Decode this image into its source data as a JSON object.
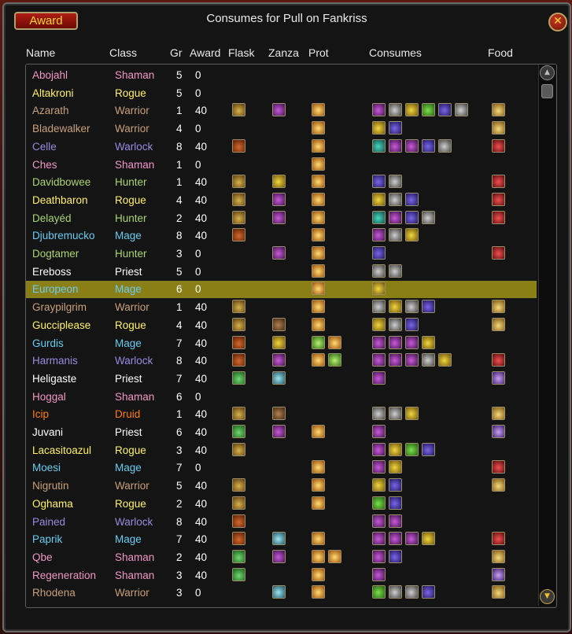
{
  "window": {
    "title": "Consumes for Pull on Fankriss",
    "award_button": "Award",
    "close_glyph": "✕"
  },
  "colors": {
    "Shaman": "#f097c6",
    "Rogue": "#fff26a",
    "Warrior": "#c8a07a",
    "Warlock": "#9a8ae0",
    "Hunter": "#abd473",
    "Mage": "#69ccf0",
    "Priest": "#ffffff",
    "Druid": "#ff7d0a"
  },
  "columns": {
    "name": "Name",
    "class": "Class",
    "gr": "Gr",
    "award": "Award",
    "flask": "Flask",
    "zanza": "Zanza",
    "prot": "Prot",
    "consumes": "Consumes",
    "food": "Food"
  },
  "rows": [
    {
      "name": "Abojahl",
      "class": "Shaman",
      "gr": "5",
      "award": "0",
      "flask": [],
      "zanza": [],
      "prot": [],
      "consumes": [],
      "food": []
    },
    {
      "name": "Altakroni",
      "class": "Rogue",
      "gr": "5",
      "award": "0",
      "flask": [],
      "zanza": [],
      "prot": [],
      "consumes": [],
      "food": []
    },
    {
      "name": "Azarath",
      "class": "Warrior",
      "gr": "1",
      "award": "40",
      "flask": [
        "flask"
      ],
      "zanza": [
        "purple"
      ],
      "prot": [
        "prot"
      ],
      "consumes": [
        "purple",
        "gray",
        "yellow",
        "green",
        "blue",
        "gray"
      ],
      "food": [
        "food"
      ]
    },
    {
      "name": "Bladewalker",
      "class": "Warrior",
      "gr": "4",
      "award": "0",
      "flask": [],
      "zanza": [],
      "prot": [
        "prot"
      ],
      "consumes": [
        "yellow",
        "blue"
      ],
      "food": [
        "food"
      ]
    },
    {
      "name": "Celle",
      "class": "Warlock",
      "gr": "8",
      "award": "40",
      "flask": [
        "flask-red"
      ],
      "zanza": [],
      "prot": [
        "prot"
      ],
      "consumes": [
        "teal",
        "purple",
        "purple",
        "blue",
        "gray"
      ],
      "food": [
        "food-red"
      ]
    },
    {
      "name": "Ches",
      "class": "Shaman",
      "gr": "1",
      "award": "0",
      "flask": [],
      "zanza": [],
      "prot": [
        "prot"
      ],
      "consumes": [],
      "food": []
    },
    {
      "name": "Davidbowee",
      "class": "Hunter",
      "gr": "1",
      "award": "40",
      "flask": [
        "flask"
      ],
      "zanza": [
        "yellow"
      ],
      "prot": [
        "prot"
      ],
      "consumes": [
        "blue",
        "gray"
      ],
      "food": [
        "food-red"
      ]
    },
    {
      "name": "Deathbaron",
      "class": "Rogue",
      "gr": "4",
      "award": "40",
      "flask": [
        "flask"
      ],
      "zanza": [
        "purple"
      ],
      "prot": [
        "prot"
      ],
      "consumes": [
        "yellow",
        "gray",
        "blue"
      ],
      "food": [
        "food-red"
      ]
    },
    {
      "name": "Delayéd",
      "class": "Hunter",
      "gr": "2",
      "award": "40",
      "flask": [
        "flask"
      ],
      "zanza": [
        "purple"
      ],
      "prot": [
        "prot"
      ],
      "consumes": [
        "teal",
        "purple",
        "blue",
        "gray"
      ],
      "food": [
        "food-red"
      ]
    },
    {
      "name": "Djubremucko",
      "class": "Mage",
      "gr": "8",
      "award": "40",
      "flask": [
        "flask-red"
      ],
      "zanza": [],
      "prot": [
        "prot"
      ],
      "consumes": [
        "purple",
        "gray",
        "yellow"
      ],
      "food": []
    },
    {
      "name": "Dogtamer",
      "class": "Hunter",
      "gr": "3",
      "award": "0",
      "flask": [],
      "zanza": [
        "purple"
      ],
      "prot": [
        "prot"
      ],
      "consumes": [
        "blue"
      ],
      "food": [
        "food-red"
      ]
    },
    {
      "name": "Ereboss",
      "class": "Priest",
      "gr": "5",
      "award": "0",
      "flask": [],
      "zanza": [],
      "prot": [
        "prot"
      ],
      "consumes": [
        "gray",
        "gray"
      ],
      "food": []
    },
    {
      "name": "Europeon",
      "class": "Mage",
      "gr": "6",
      "award": "0",
      "flask": [],
      "zanza": [],
      "prot": [
        "prot"
      ],
      "consumes": [
        "yellow"
      ],
      "food": [],
      "selected": true
    },
    {
      "name": "Graypilgrim",
      "class": "Warrior",
      "gr": "1",
      "award": "40",
      "flask": [
        "flask"
      ],
      "zanza": [],
      "prot": [
        "prot"
      ],
      "consumes": [
        "gray",
        "yellow",
        "gray",
        "blue"
      ],
      "food": [
        "food"
      ]
    },
    {
      "name": "Gucciplease",
      "class": "Rogue",
      "gr": "4",
      "award": "40",
      "flask": [
        "flask"
      ],
      "zanza": [
        "brown"
      ],
      "prot": [
        "prot"
      ],
      "consumes": [
        "yellow",
        "gray",
        "blue"
      ],
      "food": [
        "food"
      ]
    },
    {
      "name": "Gurdis",
      "class": "Mage",
      "gr": "7",
      "award": "40",
      "flask": [
        "flask-red"
      ],
      "zanza": [
        "yellow"
      ],
      "prot": [
        "prot-green",
        "prot"
      ],
      "consumes": [
        "purple",
        "purple",
        "purple",
        "yellow"
      ],
      "food": []
    },
    {
      "name": "Harmanis",
      "class": "Warlock",
      "gr": "8",
      "award": "40",
      "flask": [
        "flask-red"
      ],
      "zanza": [
        "purple"
      ],
      "prot": [
        "prot",
        "prot-green"
      ],
      "consumes": [
        "purple",
        "purple",
        "purple",
        "gray",
        "yellow"
      ],
      "food": [
        "food-red"
      ]
    },
    {
      "name": "Heligaste",
      "class": "Priest",
      "gr": "7",
      "award": "40",
      "flask": [
        "flask-green"
      ],
      "zanza": [
        "cyan"
      ],
      "prot": [],
      "consumes": [
        "purple"
      ],
      "food": [
        "food-purple"
      ]
    },
    {
      "name": "Hoggal",
      "class": "Shaman",
      "gr": "6",
      "award": "0",
      "flask": [],
      "zanza": [],
      "prot": [],
      "consumes": [],
      "food": []
    },
    {
      "name": "Icip",
      "class": "Druid",
      "gr": "1",
      "award": "40",
      "flask": [
        "flask"
      ],
      "zanza": [
        "brown"
      ],
      "prot": [],
      "consumes": [
        "gray",
        "gray",
        "yellow"
      ],
      "food": [
        "food"
      ]
    },
    {
      "name": "Juvani",
      "class": "Priest",
      "gr": "6",
      "award": "40",
      "flask": [
        "flask-green"
      ],
      "zanza": [
        "purple"
      ],
      "prot": [
        "prot"
      ],
      "consumes": [
        "purple"
      ],
      "food": [
        "food-purple"
      ]
    },
    {
      "name": "Lacasitoazul",
      "class": "Rogue",
      "gr": "3",
      "award": "40",
      "flask": [
        "flask"
      ],
      "zanza": [],
      "prot": [],
      "consumes": [
        "purple",
        "yellow",
        "green",
        "blue"
      ],
      "food": []
    },
    {
      "name": "Moesi",
      "class": "Mage",
      "gr": "7",
      "award": "0",
      "flask": [],
      "zanza": [],
      "prot": [
        "prot"
      ],
      "consumes": [
        "purple",
        "yellow"
      ],
      "food": [
        "food-red"
      ]
    },
    {
      "name": "Nigrutin",
      "class": "Warrior",
      "gr": "5",
      "award": "40",
      "flask": [
        "flask"
      ],
      "zanza": [],
      "prot": [
        "prot"
      ],
      "consumes": [
        "yellow",
        "blue"
      ],
      "food": [
        "food"
      ]
    },
    {
      "name": "Oghama",
      "class": "Rogue",
      "gr": "2",
      "award": "40",
      "flask": [
        "flask"
      ],
      "zanza": [],
      "prot": [
        "prot"
      ],
      "consumes": [
        "green",
        "blue"
      ],
      "food": []
    },
    {
      "name": "Pained",
      "class": "Warlock",
      "gr": "8",
      "award": "40",
      "flask": [
        "flask-red"
      ],
      "zanza": [],
      "prot": [],
      "consumes": [
        "purple",
        "purple"
      ],
      "food": []
    },
    {
      "name": "Paprik",
      "class": "Mage",
      "gr": "7",
      "award": "40",
      "flask": [
        "flask-red"
      ],
      "zanza": [
        "cyan"
      ],
      "prot": [
        "prot"
      ],
      "consumes": [
        "purple",
        "purple",
        "purple",
        "yellow"
      ],
      "food": [
        "food-red"
      ]
    },
    {
      "name": "Qbe",
      "class": "Shaman",
      "gr": "2",
      "award": "40",
      "flask": [
        "flask-green"
      ],
      "zanza": [
        "purple"
      ],
      "prot": [
        "prot",
        "prot"
      ],
      "consumes": [
        "purple",
        "blue"
      ],
      "food": [
        "food"
      ]
    },
    {
      "name": "Regeneration",
      "class": "Shaman",
      "gr": "3",
      "award": "40",
      "flask": [
        "flask-green"
      ],
      "zanza": [],
      "prot": [
        "prot"
      ],
      "consumes": [
        "purple"
      ],
      "food": [
        "food-purple"
      ]
    },
    {
      "name": "Rhodena",
      "class": "Warrior",
      "gr": "3",
      "award": "0",
      "flask": [],
      "zanza": [
        "cyan"
      ],
      "prot": [
        "prot"
      ],
      "consumes": [
        "green",
        "gray",
        "gray",
        "blue"
      ],
      "food": [
        "food"
      ]
    }
  ]
}
